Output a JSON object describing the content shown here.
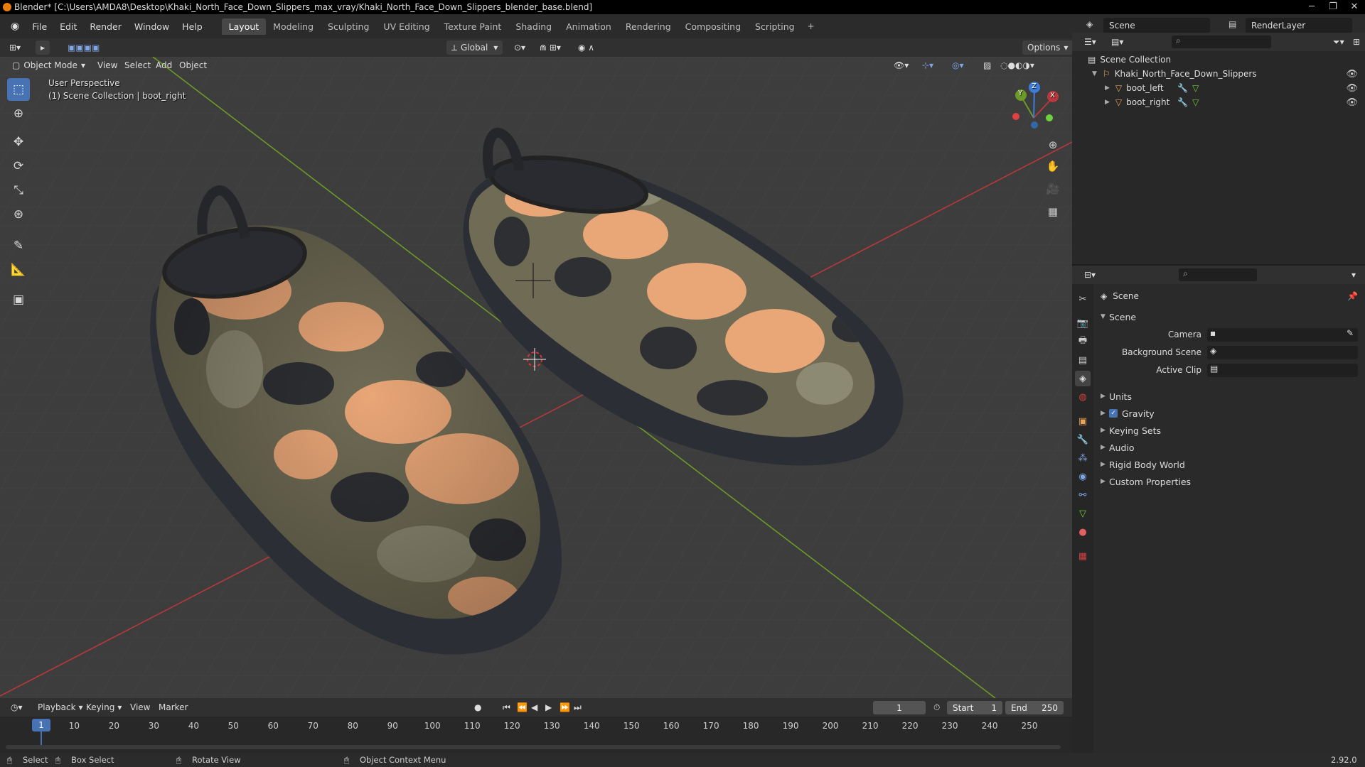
{
  "window": {
    "title": "Blender* [C:\\Users\\AMDA8\\Desktop\\Khaki_North_Face_Down_Slippers_max_vray/Khaki_North_Face_Down_Slippers_blender_base.blend]",
    "minimize": "─",
    "maximize": "❐",
    "close": "✕"
  },
  "menu": [
    "File",
    "Edit",
    "Render",
    "Window",
    "Help"
  ],
  "workspaces": [
    "Layout",
    "Modeling",
    "Sculpting",
    "UV Editing",
    "Texture Paint",
    "Shading",
    "Animation",
    "Rendering",
    "Compositing",
    "Scripting"
  ],
  "workspace_add": "+",
  "scene_name": "Scene",
  "view_layer": "RenderLayer",
  "viewport_header": {
    "mode": "Object Mode",
    "menus": [
      "View",
      "Select",
      "Add",
      "Object"
    ],
    "orientation": "Global",
    "options": "Options"
  },
  "viewport": {
    "perspective": "User Perspective",
    "collection_info": "(1) Scene Collection | boot_right",
    "gizmo_axes": {
      "x": "X",
      "y": "Y",
      "z": "Z"
    }
  },
  "outliner": {
    "root": "Scene Collection",
    "collection": "Khaki_North_Face_Down_Slippers",
    "objects": [
      "boot_left",
      "boot_right"
    ]
  },
  "properties": {
    "context": "Scene",
    "section": "Scene",
    "fields": [
      {
        "label": "Camera"
      },
      {
        "label": "Background Scene"
      },
      {
        "label": "Active Clip"
      }
    ],
    "panels": [
      "Units",
      "Gravity",
      "Keying Sets",
      "Audio",
      "Rigid Body World",
      "Custom Properties"
    ],
    "gravity_checked": true
  },
  "timeline": {
    "menus": [
      "Playback",
      "Keying",
      "View",
      "Marker"
    ],
    "current_frame": "1",
    "start_label": "Start",
    "start": "1",
    "end_label": "End",
    "end": "250",
    "ticks": [
      "1",
      "10",
      "20",
      "30",
      "40",
      "50",
      "60",
      "70",
      "80",
      "90",
      "100",
      "110",
      "120",
      "130",
      "140",
      "150",
      "160",
      "170",
      "180",
      "190",
      "200",
      "210",
      "220",
      "230",
      "240",
      "250"
    ]
  },
  "statusbar": {
    "select": "Select",
    "box_select": "Box Select",
    "rotate": "Rotate View",
    "context_menu": "Object Context Menu",
    "version": "2.92.0"
  },
  "colors": {
    "accent": "#4772b3",
    "x_axis": "#b8383b",
    "y_axis": "#6b9a26",
    "camo_tan": "#e9a677",
    "camo_olive": "#6f6b55",
    "camo_dark": "#2e2f33",
    "camo_sage": "#8c8a72",
    "sole": "#2b2e34"
  }
}
